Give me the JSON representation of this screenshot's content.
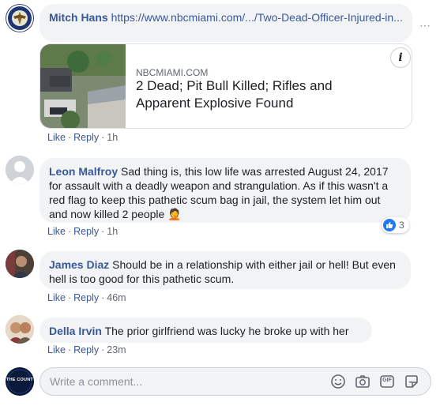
{
  "comments": [
    {
      "author": "Mitch Hans",
      "link": "https://www.nbcmiami.com/.../Two-Dead-Officer-Injured-in...",
      "card": {
        "domain": "NBCMIAMI.COM",
        "title": "2 Dead; Pit Bull Killed; Rifles and Apparent Explosive Found",
        "info": "i"
      },
      "like": "Like",
      "reply": "Reply",
      "time": "1h"
    },
    {
      "author": "Leon Malfroy",
      "text": "Sad thing is, this low life was arrested August 24, 2017 for assault with a deadly weapon and strangulation. As if this wasn't a red flag to keep this pathetic scum bag in jail, the system let him out and now killed 2 people",
      "emoji": "🤦",
      "like": "Like",
      "reply": "Reply",
      "time": "1h",
      "reactions": "3"
    },
    {
      "author": "James Diaz",
      "text": "Should be in a relationship with either jail or hell! But even hell is too good for this pathetic scum.",
      "like": "Like",
      "reply": "Reply",
      "time": "46m"
    },
    {
      "author": "Della Irvin",
      "text": "The prior girlfriend was lucky he broke up with her",
      "like": "Like",
      "reply": "Reply",
      "time": "23m"
    }
  ],
  "composer": {
    "placeholder": "Write a comment...",
    "gif_label": "GIF",
    "avatar_text": "THE COUNT"
  },
  "icons": [
    "emoji-icon",
    "camera-icon",
    "gif-icon",
    "sticker-icon"
  ],
  "colors": {
    "author": "#385898",
    "bubble": "#f2f3f5",
    "like_blue": "#2078f4"
  },
  "sep": "·"
}
